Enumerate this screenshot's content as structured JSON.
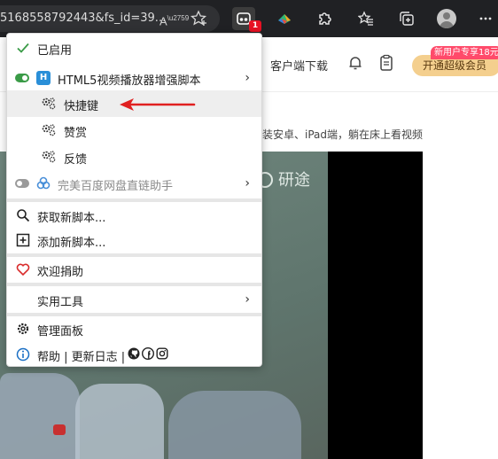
{
  "browser": {
    "url_fragment": "5168558792443&fs_id=39...",
    "read_aloud_label": "A",
    "extension_badge": "1"
  },
  "site": {
    "client_download": "客户端下载",
    "vip_button": "开通超级会员",
    "promo_tag": "新用户专享18元",
    "description": "装安卓、iPad端，躺在床上看视频",
    "video_logo": "研途"
  },
  "menu": {
    "enabled_label": "已启用",
    "script_html5": {
      "label": "HTML5视频播放器增强脚本",
      "icon_letter": "H",
      "toggle": "on"
    },
    "sub_items": [
      {
        "label": "快捷键",
        "icon": "gear-cluster-icon"
      },
      {
        "label": "赞赏",
        "icon": "gear-cluster-icon"
      },
      {
        "label": "反馈",
        "icon": "gear-cluster-icon"
      }
    ],
    "script_baidu": {
      "label": "完美百度网盘直链助手",
      "toggle": "off"
    },
    "get_new_script": "获取新脚本...",
    "add_new_script": "添加新脚本...",
    "donate": "欢迎捐助",
    "utilities": "实用工具",
    "dashboard": "管理面板",
    "help_line": "帮助 | 更新日志 |"
  },
  "colors": {
    "toolbar_bg": "#202124",
    "toggle_on": "#3a9b47",
    "annotation_arrow": "#e02020",
    "vip_gold": "#f4cf8e",
    "promo_pink": "#ff4a6a"
  }
}
